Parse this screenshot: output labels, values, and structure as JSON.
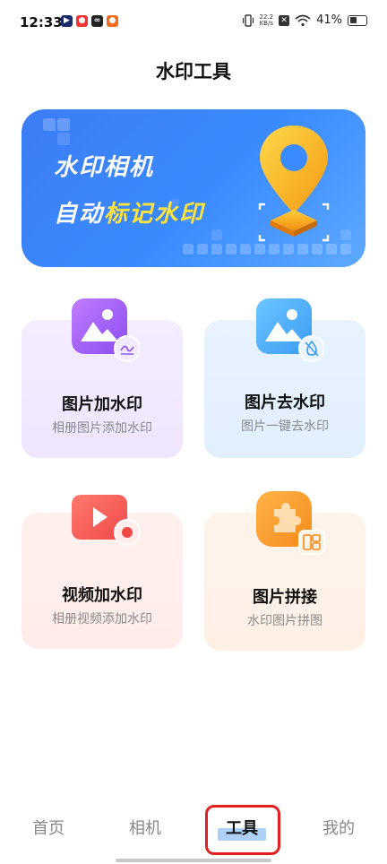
{
  "status_bar": {
    "time": "12:33",
    "net_speed_value": "22.2",
    "net_speed_unit": "KB/s",
    "battery": "41%"
  },
  "header": {
    "title": "水印工具"
  },
  "banner": {
    "line1": "水印相机",
    "line2_prefix": "自动",
    "line2_highlight": "标记水印",
    "highlight_color": "#ffe23a"
  },
  "tools": [
    {
      "title": "图片加水印",
      "subtitle": "相册图片添加水印",
      "icon": "image-watermark-icon"
    },
    {
      "title": "图片去水印",
      "subtitle": "图片一键去水印",
      "icon": "image-remove-watermark-icon"
    },
    {
      "title": "视频加水印",
      "subtitle": "相册视频添加水印",
      "icon": "video-watermark-icon"
    },
    {
      "title": "图片拼接",
      "subtitle": "水印图片拼图",
      "icon": "puzzle-icon"
    }
  ],
  "bottom_nav": {
    "items": [
      {
        "label": "首页"
      },
      {
        "label": "相机"
      },
      {
        "label": "工具"
      },
      {
        "label": "我的"
      }
    ],
    "active": "工具",
    "active_color": "#111111",
    "inactive_color": "#888888"
  }
}
